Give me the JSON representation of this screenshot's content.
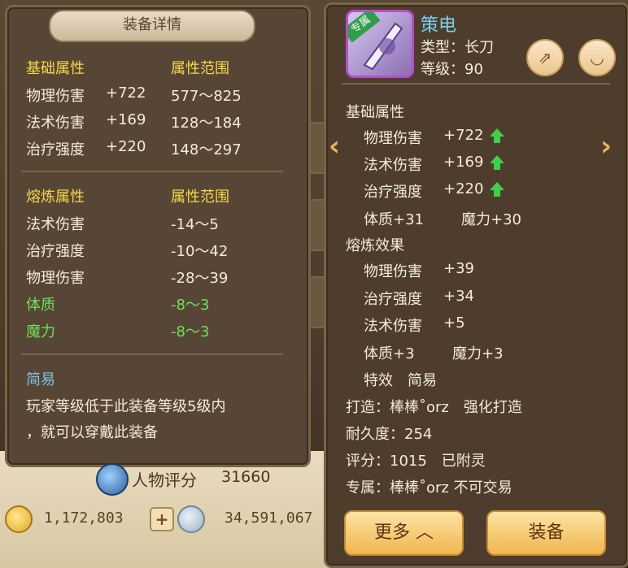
{
  "detail_panel": {
    "title": "装备详情",
    "base_header": "基础属性",
    "range_header": "属性范围",
    "base_stats": [
      {
        "name": "物理伤害",
        "value": "+722",
        "range": "577～825"
      },
      {
        "name": "法术伤害",
        "value": "+169",
        "range": "128～184"
      },
      {
        "name": "治疗强度",
        "value": "+220",
        "range": "148～297"
      }
    ],
    "refine_header": "熔炼属性",
    "refine_range_header": "属性范围",
    "refine_stats": [
      {
        "name": "法术伤害",
        "range": "-14～5",
        "green": false
      },
      {
        "name": "治疗强度",
        "range": "-10～42",
        "green": false
      },
      {
        "name": "物理伤害",
        "range": "-28～39",
        "green": false
      },
      {
        "name": "体质",
        "range": "-8～3",
        "green": true
      },
      {
        "name": "魔力",
        "range": "-8～3",
        "green": true
      }
    ],
    "effect_title": "简易",
    "effect_desc_1": "玩家等级低于此装备等级5级内",
    "effect_desc_2": "，就可以穿戴此装备"
  },
  "bottom_bar": {
    "score_label": "人物评分",
    "score_value": "31660",
    "gold": "1,172,803",
    "silver": "34,591,067",
    "plus_label": "+"
  },
  "item_panel": {
    "badge": "专属",
    "name": "策电",
    "type_line": "类型：长刀",
    "level_line": "等级：90",
    "base_header": "基础属性",
    "base_stats": [
      {
        "name": "物理伤害",
        "value": "+722"
      },
      {
        "name": "法术伤害",
        "value": "+169"
      },
      {
        "name": "治疗强度",
        "value": "+220"
      }
    ],
    "bonus_1": "体质+31",
    "bonus_2": "魔力+30",
    "refine_header": "熔炼效果",
    "refine_stats": [
      {
        "name": "物理伤害",
        "value": "+39"
      },
      {
        "name": "治疗强度",
        "value": "+34"
      },
      {
        "name": "法术伤害",
        "value": "+5"
      }
    ],
    "refine_bonus_1": "体质+3",
    "refine_bonus_2": "魔力+3",
    "special_label": "特效",
    "special_value": "简易",
    "forge_line": "打造：棒棒˚orz　强化打造",
    "durability_line": "耐久度：254",
    "score_line": "评分：1015　已附灵",
    "exclusive_line": "专属：棒棒˚orz 不可交易",
    "more_button": "更多 ︿",
    "equip_button": "装备",
    "nav_left": "‹",
    "nav_right": "›",
    "share_icon_glyph": "⇗",
    "eye_icon_glyph": "◡"
  },
  "colors": {
    "header": "#f7d94a",
    "green": "#6fe05a",
    "cyan": "#7cc4e6"
  }
}
